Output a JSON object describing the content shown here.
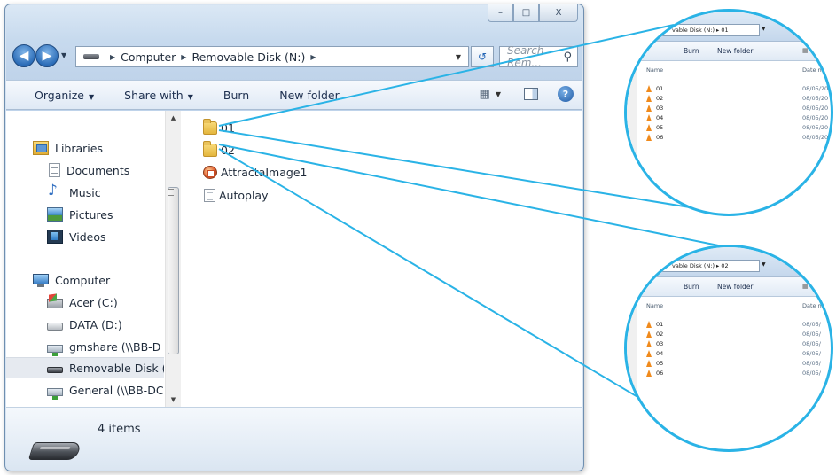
{
  "window": {
    "caption_minimize": "–",
    "caption_maximize": "□",
    "caption_close": "X"
  },
  "address_bar": {
    "breadcrumbs": [
      "Computer",
      "Removable Disk (N:)"
    ],
    "search_placeholder": "Search Rem..."
  },
  "toolbar": {
    "organize": "Organize",
    "share_with": "Share with",
    "burn": "Burn",
    "new_folder": "New folder"
  },
  "nav_pane": {
    "items": [
      {
        "label": "Libraries",
        "icon": "libraries-icon"
      },
      {
        "label": "Documents",
        "icon": "documents-icon"
      },
      {
        "label": "Music",
        "icon": "music-icon"
      },
      {
        "label": "Pictures",
        "icon": "pictures-icon"
      },
      {
        "label": "Videos",
        "icon": "videos-icon"
      },
      {
        "label": "Computer",
        "icon": "computer-icon"
      },
      {
        "label": "Acer (C:)",
        "icon": "os-drive-icon"
      },
      {
        "label": "DATA (D:)",
        "icon": "hard-drive-icon"
      },
      {
        "label": "gmshare (\\\\BB-D",
        "icon": "network-drive-icon"
      },
      {
        "label": "Removable Disk (",
        "icon": "removable-disk-icon",
        "selected": true
      },
      {
        "label": "General (\\\\BB-DC",
        "icon": "network-drive-icon"
      }
    ]
  },
  "files": [
    {
      "name": "01",
      "icon": "folder-icon"
    },
    {
      "name": "02",
      "icon": "folder-icon"
    },
    {
      "name": "AttractaImage1",
      "icon": "application-icon"
    },
    {
      "name": "Autoplay",
      "icon": "text-file-icon"
    }
  ],
  "details": {
    "item_count": "4 items"
  },
  "zoom_views": [
    {
      "address": "vable Disk (N:) ▸ 01",
      "burn": "Burn",
      "new_folder": "New folder",
      "name_header": "Name",
      "date_header": "Date m",
      "rows": [
        {
          "name": "01",
          "date": "08/05/20"
        },
        {
          "name": "02",
          "date": "08/05/20"
        },
        {
          "name": "03",
          "date": "08/05/20"
        },
        {
          "name": "04",
          "date": "08/05/20"
        },
        {
          "name": "05",
          "date": "08/05/20"
        },
        {
          "name": "06",
          "date": "08/05/20"
        }
      ]
    },
    {
      "address": "vable Disk (N:) ▸ 02",
      "burn": "Burn",
      "new_folder": "New folder",
      "name_header": "Name",
      "date_header": "Date m",
      "rows": [
        {
          "name": "01",
          "date": "08/05/"
        },
        {
          "name": "02",
          "date": "08/05/"
        },
        {
          "name": "03",
          "date": "08/05/"
        },
        {
          "name": "04",
          "date": "08/05/"
        },
        {
          "name": "05",
          "date": "08/05/"
        },
        {
          "name": "06",
          "date": "08/05/"
        }
      ]
    }
  ],
  "colors": {
    "callout": "#2ab3e6",
    "vlc_cone": "#f08a1c"
  }
}
